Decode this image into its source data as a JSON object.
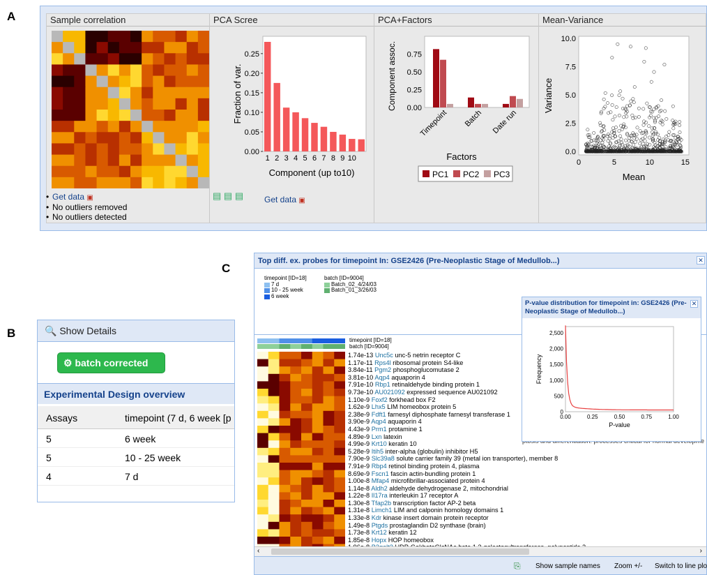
{
  "labels": {
    "a": "A",
    "b": "B",
    "c": "C"
  },
  "panelA": {
    "headers": [
      "Sample correlation",
      "PCA Scree",
      "PCA+Factors",
      "Mean-Variance"
    ],
    "get_data": "Get data",
    "bullets": [
      "No outliers removed",
      "No outliers detected"
    ]
  },
  "panelB": {
    "show_details": "Show Details",
    "batch_button": "batch corrected",
    "ed_title": "Experimental Design overview",
    "columns": [
      "Assays",
      "timepoint (7 d, 6 week [p"
    ],
    "rows": [
      [
        "5",
        "6 week"
      ],
      [
        "5",
        "10 - 25 week"
      ],
      [
        "4",
        "7 d"
      ]
    ]
  },
  "panelC": {
    "title": "Top diff. ex. probes for timepoint In: GSE2426 (Pre-Neoplastic Stage of Medullob...)",
    "legend_timepoint": "timepoint [ID=18]",
    "tp_items": [
      "7 d",
      "10 - 25 week",
      "6 week"
    ],
    "legend_batch": "batch [ID=9004]",
    "batch_items": [
      "Batch_02_4/24/03",
      "Batch_01_3/26/03"
    ],
    "col_labels": [
      "timepoint [ID=18]",
      "batch [ID=9004]"
    ],
    "genes": [
      [
        "1.74e-13",
        "Unc5c",
        "unc-5 netrin receptor C"
      ],
      [
        "1.17e-11",
        "Rps4l",
        "ribosomal protein S4-like"
      ],
      [
        "3.84e-11",
        "Pgm2",
        "phosphoglucomutase 2"
      ],
      [
        "3.81e-10",
        "Aqp4",
        "aquaporin 4"
      ],
      [
        "7.91e-10",
        "Rbp1",
        "retinaldehyde binding protein 1"
      ],
      [
        "9.73e-10",
        "AU021092",
        "expressed sequence AU021092"
      ],
      [
        "1.10e-9",
        "Foxf2",
        "forkhead box F2"
      ],
      [
        "1.62e-9",
        "Lhx5",
        "LIM homeobox protein 5"
      ],
      [
        "2.38e-9",
        "Fdft1",
        "farnesyl diphosphate farnesyl transferase 1"
      ],
      [
        "3.90e-9",
        "Aqp4",
        "aquaporin 4"
      ],
      [
        "4.43e-9",
        "Prm1",
        "protamine 1"
      ],
      [
        "4.89e-9",
        "Lxn",
        "latexin"
      ],
      [
        "4.99e-9",
        "Krt10",
        "keratin 10"
      ],
      [
        "5.28e-9",
        "Itih5",
        "inter-alpha (globulin) inhibitor H5"
      ],
      [
        "7.90e-9",
        "Slc39a8",
        "solute carrier family 39 (metal ion transporter), member 8"
      ],
      [
        "7.91e-9",
        "Rbp4",
        "retinol binding protein 4, plasma"
      ],
      [
        "8.69e-9",
        "Fscn1",
        "fascin actin-bundling protein 1"
      ],
      [
        "1.00e-8",
        "Mfap4",
        "microfibrillar-associated protein 4"
      ],
      [
        "1.14e-8",
        "Aldh2",
        "aldehyde dehydrogenase 2, mitochondrial"
      ],
      [
        "1.22e-8",
        "Il17ra",
        "interleukin 17 receptor A"
      ],
      [
        "1.30e-8",
        "Tfap2b",
        "transcription factor AP-2 beta"
      ],
      [
        "1.31e-8",
        "Limch1",
        "LIM and calponin homology domains 1"
      ],
      [
        "1.33e-8",
        "Kdr",
        "kinase insert domain protein receptor"
      ],
      [
        "1.49e-8",
        "Ptgds",
        "prostaglandin D2 synthase (brain)"
      ],
      [
        "1.73e-8",
        "Krt12",
        "keratin 12"
      ],
      [
        "1.85e-8",
        "Hopx",
        "HOP homeobox"
      ],
      [
        "1.96e-8",
        "B3galt2",
        "UDP-Gal:betaGlcNAc beta 1,3-galactosyltransferase, polypeptide 2"
      ]
    ],
    "hidden_text": "ptosis and differentiation: processes critical for normal developme",
    "footer": {
      "show_names": "Show sample names",
      "zoom": "Zoom +/-",
      "switch": "Switch to line plot"
    },
    "popup_title": "P-value distribution for timepoint in: GSE2426 (Pre-Neoplastic Stage of Medullob...)"
  },
  "chart_data": [
    {
      "type": "heatmap",
      "title": "Sample correlation",
      "note": "14x14 sample correlation matrix"
    },
    {
      "type": "bar",
      "title": "PCA Scree",
      "xlabel": "Component (up to10)",
      "ylabel": "Fraction of var.",
      "categories": [
        "1",
        "2",
        "3",
        "4",
        "5",
        "6",
        "7",
        "8",
        "9",
        "10"
      ],
      "values": [
        0.28,
        0.175,
        0.112,
        0.1,
        0.085,
        0.073,
        0.063,
        0.05,
        0.043,
        0.032,
        0.031
      ],
      "ylim": [
        0,
        0.28
      ],
      "yticks": [
        "0.00",
        "0.05",
        "0.10",
        "0.15",
        "0.20",
        "0.25"
      ],
      "color": "#f4585a"
    },
    {
      "type": "bar",
      "title": "PCA+Factors",
      "xlabel": "Factors",
      "ylabel": "Component assoc.",
      "categories": [
        "Timepoint",
        "Batch",
        "Date run"
      ],
      "series": [
        {
          "name": "PC1",
          "values": [
            0.82,
            0.14,
            0.05
          ],
          "color": "#a00a14"
        },
        {
          "name": "PC2",
          "values": [
            0.67,
            0.05,
            0.16
          ],
          "color": "#c04a50"
        },
        {
          "name": "PC3",
          "values": [
            0.05,
            0.05,
            0.12
          ],
          "color": "#c4a0a0"
        }
      ],
      "ylim": [
        0,
        1
      ],
      "yticks": [
        "0.00",
        "0.25",
        "0.50",
        "0.75"
      ]
    },
    {
      "type": "scatter",
      "title": "Mean-Variance",
      "xlabel": "Mean",
      "ylabel": "Variance",
      "xlim": [
        0,
        15.5
      ],
      "ylim": [
        -0.3,
        10.2
      ],
      "xticks": [
        "0",
        "5",
        "10",
        "15"
      ],
      "yticks": [
        "0.0",
        "2.5",
        "5.0",
        "7.5",
        "10.0"
      ]
    },
    {
      "type": "line",
      "title": "P-value distribution",
      "xlabel": "P-value",
      "ylabel": "Frequency",
      "xticks": [
        "0.00",
        "0.25",
        "0.50",
        "0.75",
        "1.00"
      ],
      "yticks": [
        "0",
        "500",
        "1,000",
        "1,500",
        "2,000",
        "2,500"
      ],
      "ylim": [
        0,
        2700
      ],
      "color": "#e84040"
    }
  ]
}
